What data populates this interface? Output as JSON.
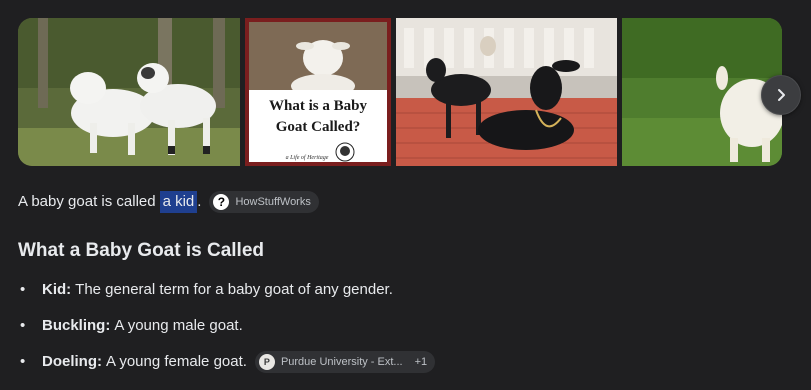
{
  "images": [
    {
      "name": "goat-kids-on-grass",
      "alt": "Two white baby goats on grass"
    },
    {
      "name": "what-is-a-baby-goat-called-card",
      "title_line1": "What is a Baby",
      "title_line2": "Goat Called?",
      "footer": "a Life of Heritage"
    },
    {
      "name": "black-goats-on-brick",
      "alt": "Black goats resting on red brick"
    },
    {
      "name": "white-kid-in-grass",
      "alt": "White baby goat in grass"
    }
  ],
  "answer": {
    "prefix": "A baby goat is called",
    "highlight": "a kid",
    "suffix": ".",
    "source": "HowStuffWorks",
    "source_icon": "?"
  },
  "section_heading": "What a Baby Goat is Called",
  "definitions": [
    {
      "term": "Kid:",
      "text": "The general term for a baby goat of any gender."
    },
    {
      "term": "Buckling:",
      "text": "A young male goat."
    },
    {
      "term": "Doeling:",
      "text": "A young female goat.",
      "source": "Purdue University - Ext...",
      "source_icon": "P",
      "extra": "+1"
    }
  ],
  "bullet": "•"
}
